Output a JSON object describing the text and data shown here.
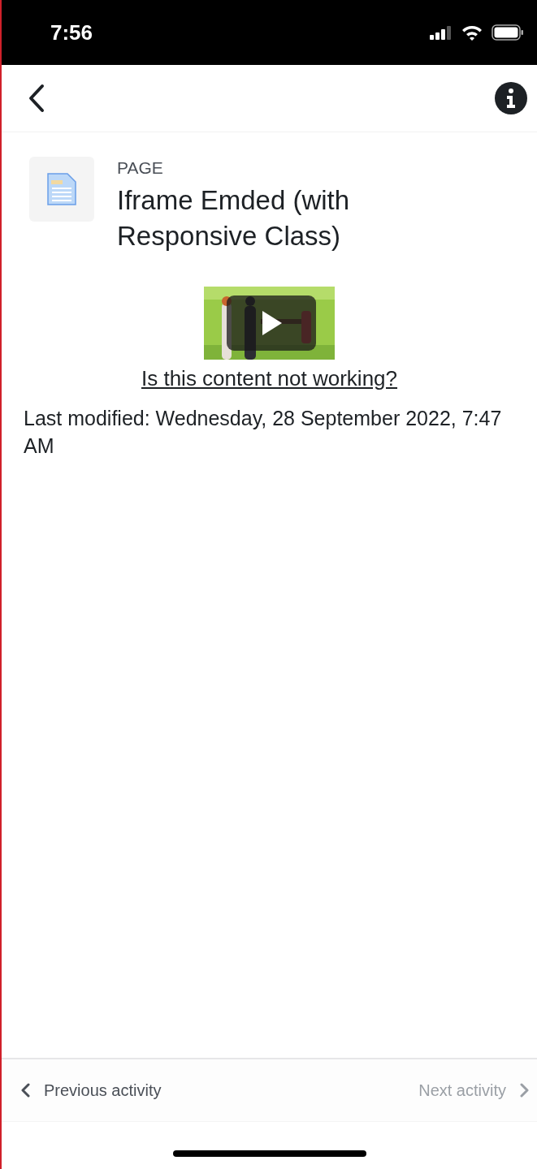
{
  "status_bar": {
    "time": "7:56"
  },
  "module": {
    "type_label": "PAGE",
    "title": "Iframe Emded (with Responsive Class)"
  },
  "content": {
    "help_link": "Is this content not working?"
  },
  "last_modified": "Last modified: Wednesday, 28 September 2022, 7:47 AM",
  "navigation": [
    {
      "label": "Previous activity",
      "kind": "previous",
      "disabled": false
    },
    {
      "label": "Next activity",
      "kind": "next",
      "disabled": true
    }
  ]
}
